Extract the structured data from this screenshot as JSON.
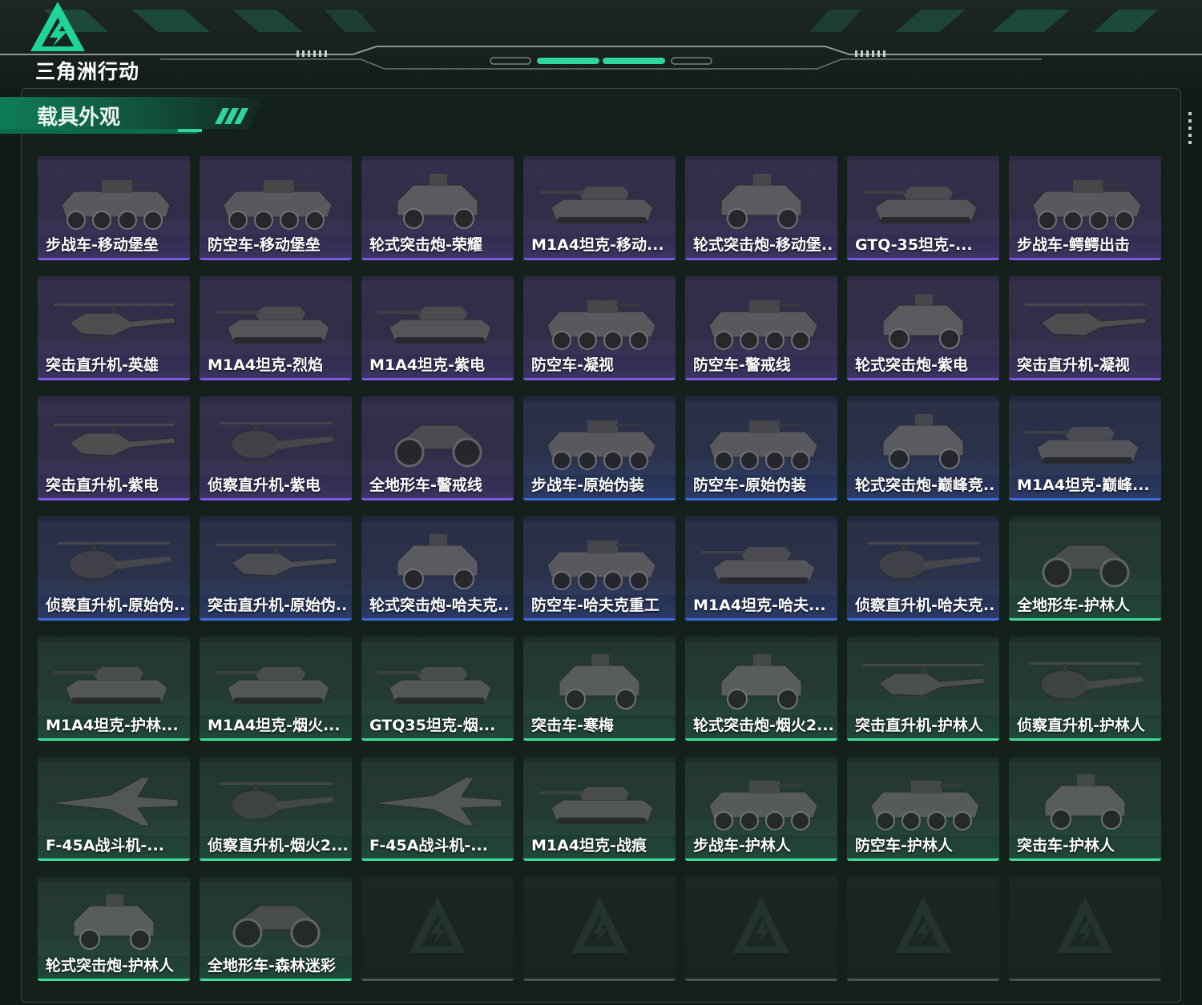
{
  "app": {
    "logo_text": "三角洲行动",
    "page_title": "载具外观"
  },
  "colors": {
    "purple": "#7a55e6",
    "blue": "#3f6ae0",
    "green": "#3ddc9a",
    "empty": "#4a5550",
    "accent": "#1fd39a"
  },
  "items": [
    {
      "name": "步战车-移动堡垒",
      "rarity": "purple",
      "kind": "ifv8"
    },
    {
      "name": "防空车-移动堡垒",
      "rarity": "purple",
      "kind": "ifv8"
    },
    {
      "name": "轮式突击炮-荣耀",
      "rarity": "purple",
      "kind": "car4"
    },
    {
      "name": "M1A4坦克-移动...",
      "rarity": "purple",
      "kind": "tank"
    },
    {
      "name": "轮式突击炮-移动堡...",
      "rarity": "purple",
      "kind": "car4"
    },
    {
      "name": "GTQ-35坦克-...",
      "rarity": "purple",
      "kind": "tank"
    },
    {
      "name": "步战车-鳄鳄出击",
      "rarity": "purple",
      "kind": "ifv8"
    },
    {
      "name": "突击直升机-英雄",
      "rarity": "purple",
      "kind": "heli"
    },
    {
      "name": "M1A4坦克-烈焰",
      "rarity": "purple",
      "kind": "tank"
    },
    {
      "name": "M1A4坦克-紫电",
      "rarity": "purple",
      "kind": "tank"
    },
    {
      "name": "防空车-凝视",
      "rarity": "purple",
      "kind": "ifv8"
    },
    {
      "name": "防空车-警戒线",
      "rarity": "purple",
      "kind": "ifv8"
    },
    {
      "name": "轮式突击炮-紫电",
      "rarity": "purple",
      "kind": "car4"
    },
    {
      "name": "突击直升机-凝视",
      "rarity": "purple",
      "kind": "heli"
    },
    {
      "name": "突击直升机-紫电",
      "rarity": "purple",
      "kind": "heli"
    },
    {
      "name": "侦察直升机-紫电",
      "rarity": "purple",
      "kind": "scout"
    },
    {
      "name": "全地形车-警戒线",
      "rarity": "purple",
      "kind": "atv"
    },
    {
      "name": "步战车-原始伪装",
      "rarity": "blue",
      "kind": "ifv8"
    },
    {
      "name": "防空车-原始伪装",
      "rarity": "blue",
      "kind": "ifv8"
    },
    {
      "name": "轮式突击炮-巅峰竞...",
      "rarity": "blue",
      "kind": "car4"
    },
    {
      "name": "M1A4坦克-巅峰...",
      "rarity": "blue",
      "kind": "tank"
    },
    {
      "name": "侦察直升机-原始伪...",
      "rarity": "blue",
      "kind": "scout"
    },
    {
      "name": "突击直升机-原始伪...",
      "rarity": "blue",
      "kind": "heli"
    },
    {
      "name": "轮式突击炮-哈夫克...",
      "rarity": "blue",
      "kind": "car4"
    },
    {
      "name": "防空车-哈夫克重工",
      "rarity": "blue",
      "kind": "ifv8"
    },
    {
      "name": "M1A4坦克-哈夫...",
      "rarity": "blue",
      "kind": "tank"
    },
    {
      "name": "侦察直升机-哈夫克...",
      "rarity": "blue",
      "kind": "scout"
    },
    {
      "name": "全地形车-护林人",
      "rarity": "green",
      "kind": "atv"
    },
    {
      "name": "M1A4坦克-护林...",
      "rarity": "green",
      "kind": "tank"
    },
    {
      "name": "M1A4坦克-烟火...",
      "rarity": "green",
      "kind": "tank"
    },
    {
      "name": "GTQ35坦克-烟...",
      "rarity": "green",
      "kind": "tank"
    },
    {
      "name": "突击车-寒梅",
      "rarity": "green",
      "kind": "car4"
    },
    {
      "name": "轮式突击炮-烟火2...",
      "rarity": "green",
      "kind": "car4"
    },
    {
      "name": "突击直升机-护林人",
      "rarity": "green",
      "kind": "heli"
    },
    {
      "name": "侦察直升机-护林人",
      "rarity": "green",
      "kind": "scout"
    },
    {
      "name": "F-45A战斗机-...",
      "rarity": "green",
      "kind": "jet"
    },
    {
      "name": "侦察直升机-烟火2...",
      "rarity": "green",
      "kind": "scout"
    },
    {
      "name": "F-45A战斗机-...",
      "rarity": "green",
      "kind": "jet"
    },
    {
      "name": "M1A4坦克-战痕",
      "rarity": "green",
      "kind": "tank"
    },
    {
      "name": "步战车-护林人",
      "rarity": "green",
      "kind": "ifv8"
    },
    {
      "name": "防空车-护林人",
      "rarity": "green",
      "kind": "ifv8"
    },
    {
      "name": "突击车-护林人",
      "rarity": "green",
      "kind": "car4"
    },
    {
      "name": "轮式突击炮-护林人",
      "rarity": "green",
      "kind": "car4"
    },
    {
      "name": "全地形车-森林迷彩",
      "rarity": "green",
      "kind": "atv"
    },
    {
      "name": "",
      "rarity": "empty",
      "kind": "empty"
    },
    {
      "name": "",
      "rarity": "empty",
      "kind": "empty"
    },
    {
      "name": "",
      "rarity": "empty",
      "kind": "empty"
    },
    {
      "name": "",
      "rarity": "empty",
      "kind": "empty"
    },
    {
      "name": "",
      "rarity": "empty",
      "kind": "empty"
    }
  ]
}
